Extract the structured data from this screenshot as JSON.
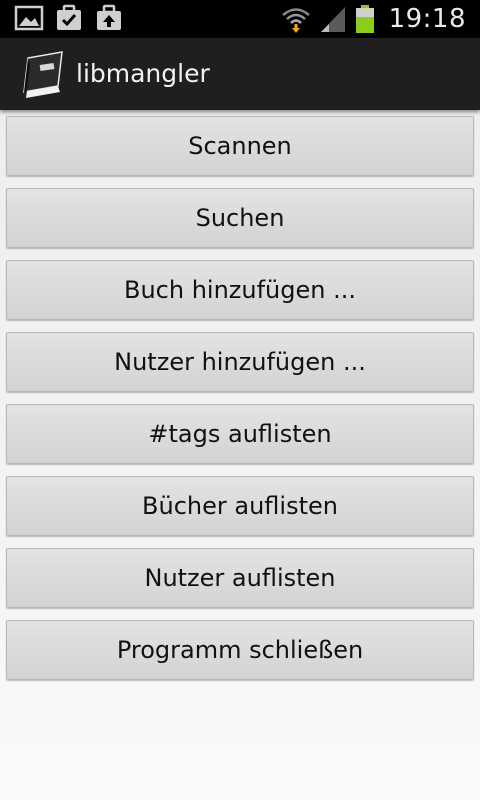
{
  "status_bar": {
    "left_icons": [
      "image-icon",
      "clipboard-check-icon",
      "briefcase-upload-icon"
    ],
    "right_icons": [
      "wifi-icon",
      "signal-icon",
      "battery-icon"
    ],
    "time": "19:18"
  },
  "action_bar": {
    "app_icon": "book-icon",
    "title": "libmangler"
  },
  "menu": {
    "buttons": [
      {
        "label": "Scannen"
      },
      {
        "label": "Suchen"
      },
      {
        "label": "Buch hinzufügen ..."
      },
      {
        "label": "Nutzer hinzufügen ..."
      },
      {
        "label": "#tags auflisten"
      },
      {
        "label": "Bücher auflisten"
      },
      {
        "label": "Nutzer auflisten"
      },
      {
        "label": "Programm schließen"
      }
    ]
  },
  "colors": {
    "status_bar_bg": "#000000",
    "action_bar_bg": "#1f1f1f",
    "button_bg": "#dadada",
    "wifi_accent": "#f5a623",
    "battery_green": "#8ccc1a"
  }
}
